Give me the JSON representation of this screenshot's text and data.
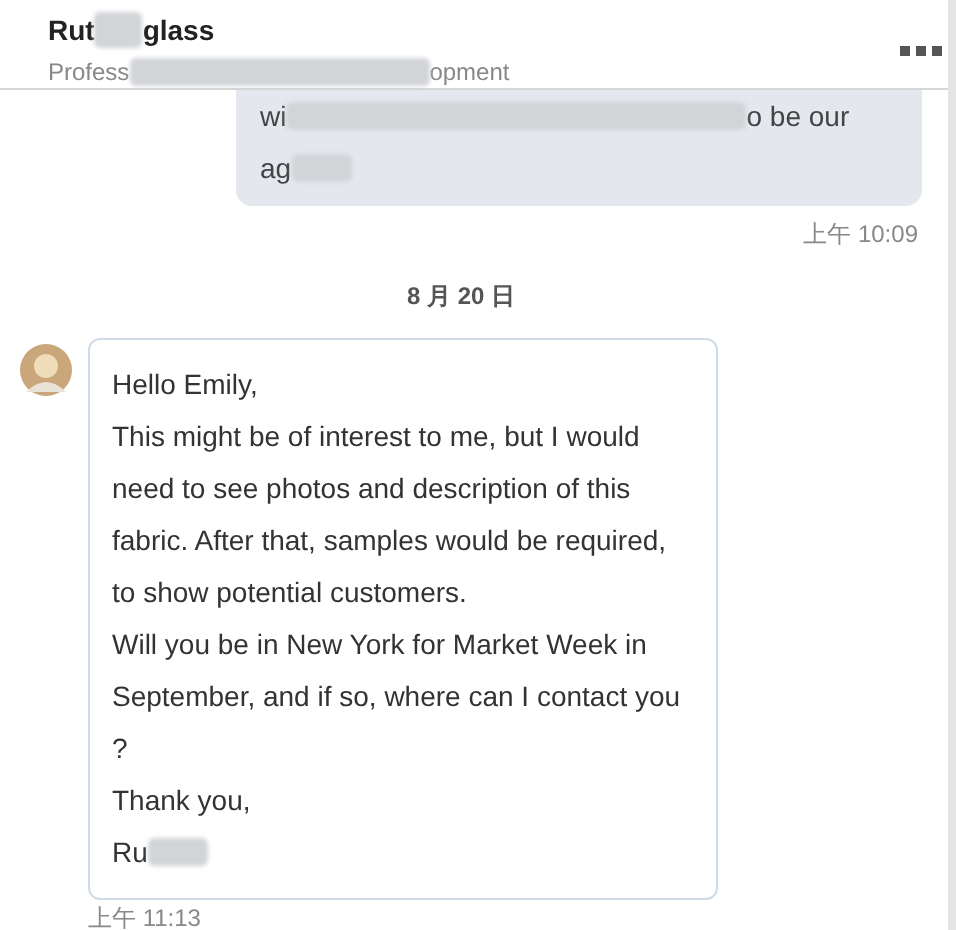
{
  "header": {
    "name": [
      "Rut",
      "glass"
    ],
    "subtitle": [
      "Profess",
      "opment"
    ]
  },
  "messages": [
    {
      "kind": "sent",
      "lines": [
        {
          "parts": [
            "wi",
            "o be our"
          ],
          "blurred_tail": false
        },
        {
          "parts": [
            "ag"
          ],
          "blurred_tail": true
        }
      ],
      "time": "上午 10:09"
    },
    {
      "kind": "date",
      "text": "8 月 20 日"
    },
    {
      "kind": "received",
      "lines": [
        {
          "parts": [
            "Hello Emily,"
          ],
          "blurred_tail": false
        },
        {
          "parts": [
            "This might be of interest to me, but I would"
          ],
          "blurred_tail": false
        },
        {
          "parts": [
            "need to see photos and description of this"
          ],
          "blurred_tail": false
        },
        {
          "parts": [
            "fabric. After that, samples would be required,"
          ],
          "blurred_tail": false
        },
        {
          "parts": [
            "to show potential customers."
          ],
          "blurred_tail": false
        },
        {
          "parts": [
            "Will you be in New York for Market Week in"
          ],
          "blurred_tail": false
        },
        {
          "parts": [
            "September, and if so, where can I contact you"
          ],
          "blurred_tail": false
        },
        {
          "parts": [
            "?"
          ],
          "blurred_tail": false
        },
        {
          "parts": [
            "Thank you,"
          ],
          "blurred_tail": false
        },
        {
          "parts": [
            "Ru"
          ],
          "blurred_tail": true
        }
      ],
      "time": "上午 11:13"
    }
  ]
}
